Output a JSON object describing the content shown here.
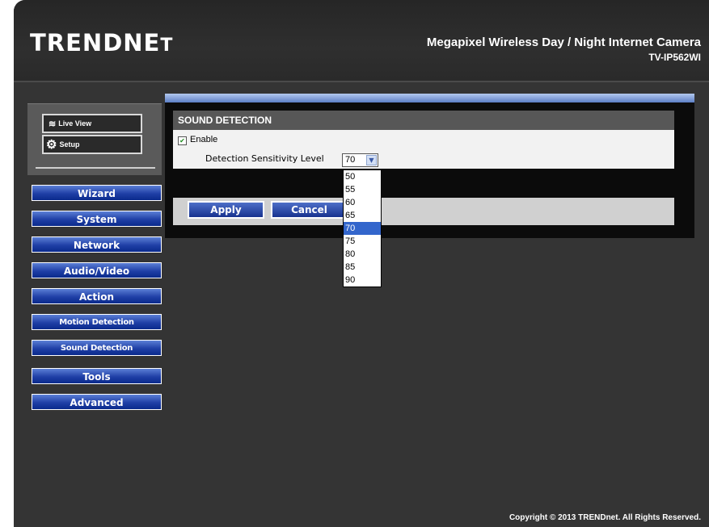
{
  "header": {
    "brand_main": "TRENDNE",
    "brand_small": "T",
    "product_title": "Megapixel Wireless Day / Night Internet Camera",
    "model": "TV-IP562WI"
  },
  "top_menu": {
    "live_view": "Live View",
    "setup": "Setup"
  },
  "nav": {
    "items": [
      {
        "label": "Wizard"
      },
      {
        "label": "System"
      },
      {
        "label": "Network"
      },
      {
        "label": "Audio/Video"
      },
      {
        "label": "Action"
      },
      {
        "label": "Motion Detection"
      },
      {
        "label": "Sound Detection"
      },
      {
        "label": "Tools"
      },
      {
        "label": "Advanced"
      }
    ]
  },
  "panel": {
    "title": "SOUND DETECTION",
    "enable_label": "Enable",
    "enable_checked": true,
    "sensitivity_label": "Detection Sensitivity Level",
    "sensitivity_value": "70",
    "options": [
      "50",
      "55",
      "60",
      "65",
      "70",
      "75",
      "80",
      "85",
      "90"
    ],
    "apply_label": "Apply",
    "cancel_label": "Cancel"
  },
  "footer": {
    "copyright": "Copyright © 2013 TRENDnet. All Rights Reserved."
  },
  "colors": {
    "nav_button": "#1f3fa6",
    "selected_option": "#3366cc",
    "background": "#343434"
  }
}
